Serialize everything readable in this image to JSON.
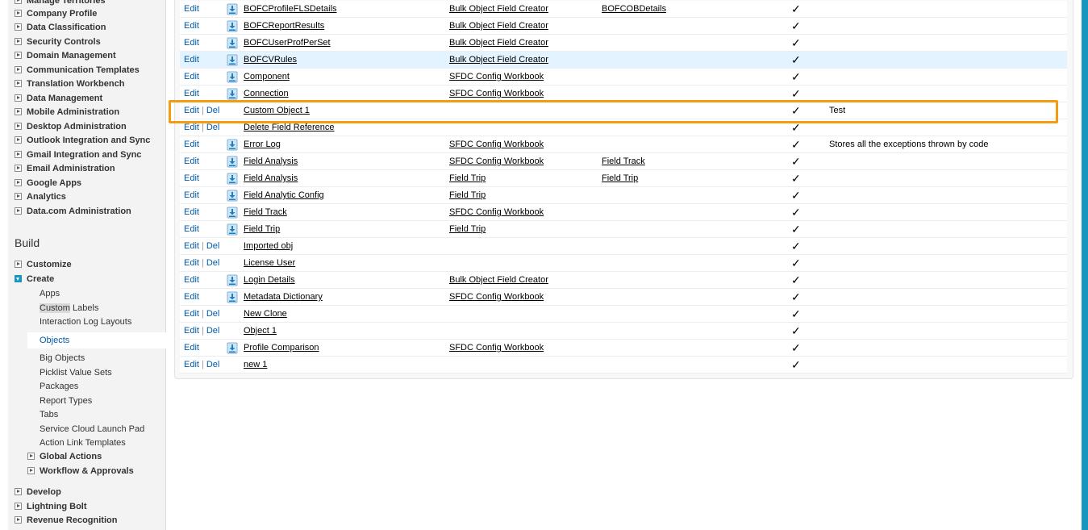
{
  "sidebar": {
    "items_top": [
      {
        "label": "Manage Territories"
      },
      {
        "label": "Company Profile"
      },
      {
        "label": "Data Classification"
      },
      {
        "label": "Security Controls"
      },
      {
        "label": "Domain Management"
      },
      {
        "label": "Communication Templates"
      },
      {
        "label": "Translation Workbench"
      },
      {
        "label": "Data Management"
      },
      {
        "label": "Mobile Administration"
      },
      {
        "label": "Desktop Administration"
      },
      {
        "label": "Outlook Integration and Sync"
      },
      {
        "label": "Gmail Integration and Sync"
      },
      {
        "label": "Email Administration"
      },
      {
        "label": "Google Apps"
      },
      {
        "label": "Analytics"
      },
      {
        "label": "Data.com Administration"
      }
    ],
    "build_heading": "Build",
    "customize": "Customize",
    "create": "Create",
    "create_items": [
      {
        "label": "Apps"
      },
      {
        "label": "Custom Labels"
      },
      {
        "label": "Interaction Log Layouts"
      },
      {
        "label": "Objects"
      },
      {
        "label": "Big Objects"
      },
      {
        "label": "Picklist Value Sets"
      },
      {
        "label": "Packages"
      },
      {
        "label": "Report Types"
      },
      {
        "label": "Tabs"
      },
      {
        "label": "Service Cloud Launch Pad"
      },
      {
        "label": "Action Link Templates"
      }
    ],
    "global_actions": "Global Actions",
    "workflow": "Workflow & Approvals",
    "develop": "Develop",
    "lightning_bolt": "Lightning Bolt",
    "revenue_recognition": "Revenue Recognition"
  },
  "table": {
    "edit_label": "Edit",
    "del_label": "Del",
    "separator": "|",
    "check": "✓",
    "rows": [
      {
        "label": "BOFCProfileFLSDetails",
        "package": "Bulk Object Field Creator",
        "related": "BOFCOBDetails",
        "managed": true,
        "del": false,
        "desc": ""
      },
      {
        "label": "BOFCReportResults",
        "package": "Bulk Object Field Creator",
        "related": "",
        "managed": true,
        "del": false,
        "desc": ""
      },
      {
        "label": "BOFCUserProfPerSet",
        "package": "Bulk Object Field Creator",
        "related": "",
        "managed": true,
        "del": false,
        "desc": ""
      },
      {
        "label": "BOFCVRules",
        "package": "Bulk Object Field Creator",
        "related": "",
        "managed": true,
        "del": false,
        "desc": ""
      },
      {
        "label": "Component",
        "package": "SFDC Config Workbook",
        "related": "",
        "managed": true,
        "del": false,
        "desc": ""
      },
      {
        "label": "Connection",
        "package": "SFDC Config Workbook",
        "related": "",
        "managed": true,
        "del": false,
        "desc": ""
      },
      {
        "label": "Custom Object 1",
        "package": "",
        "related": "",
        "managed": false,
        "del": true,
        "desc": "Test"
      },
      {
        "label": "Delete Field Reference",
        "package": "",
        "related": "",
        "managed": false,
        "del": true,
        "desc": ""
      },
      {
        "label": "Error Log",
        "package": "SFDC Config Workbook",
        "related": "",
        "managed": true,
        "del": false,
        "desc": "Stores all the exceptions thrown by code"
      },
      {
        "label": "Field Analysis",
        "package": "SFDC Config Workbook",
        "related": "Field Track",
        "managed": true,
        "del": false,
        "desc": ""
      },
      {
        "label": "Field Analysis",
        "package": "Field Trip",
        "related": "Field Trip",
        "managed": true,
        "del": false,
        "desc": ""
      },
      {
        "label": "Field Analytic Config",
        "package": "Field Trip",
        "related": "",
        "managed": true,
        "del": false,
        "desc": ""
      },
      {
        "label": "Field Track",
        "package": "SFDC Config Workbook",
        "related": "",
        "managed": true,
        "del": false,
        "desc": ""
      },
      {
        "label": "Field Trip",
        "package": "Field Trip",
        "related": "",
        "managed": true,
        "del": false,
        "desc": ""
      },
      {
        "label": "Imported obj",
        "package": "",
        "related": "",
        "managed": false,
        "del": true,
        "desc": ""
      },
      {
        "label": "License User",
        "package": "",
        "related": "",
        "managed": false,
        "del": true,
        "desc": ""
      },
      {
        "label": "Login Details",
        "package": "Bulk Object Field Creator",
        "related": "",
        "managed": true,
        "del": false,
        "desc": ""
      },
      {
        "label": "Metadata Dictionary",
        "package": "SFDC Config Workbook",
        "related": "",
        "managed": true,
        "del": false,
        "desc": ""
      },
      {
        "label": "New Clone",
        "package": "",
        "related": "",
        "managed": false,
        "del": true,
        "desc": ""
      },
      {
        "label": "Object 1",
        "package": "",
        "related": "",
        "managed": false,
        "del": true,
        "desc": ""
      },
      {
        "label": "Profile Comparison",
        "package": "SFDC Config Workbook",
        "related": "",
        "managed": true,
        "del": false,
        "desc": ""
      },
      {
        "label": "new 1",
        "package": "",
        "related": "",
        "managed": false,
        "del": true,
        "desc": ""
      }
    ]
  },
  "colors": {
    "link": "#015ba7",
    "highlight_border": "#f39c12",
    "hover_row": "#e3f3ff",
    "frame": "#1797c0"
  }
}
